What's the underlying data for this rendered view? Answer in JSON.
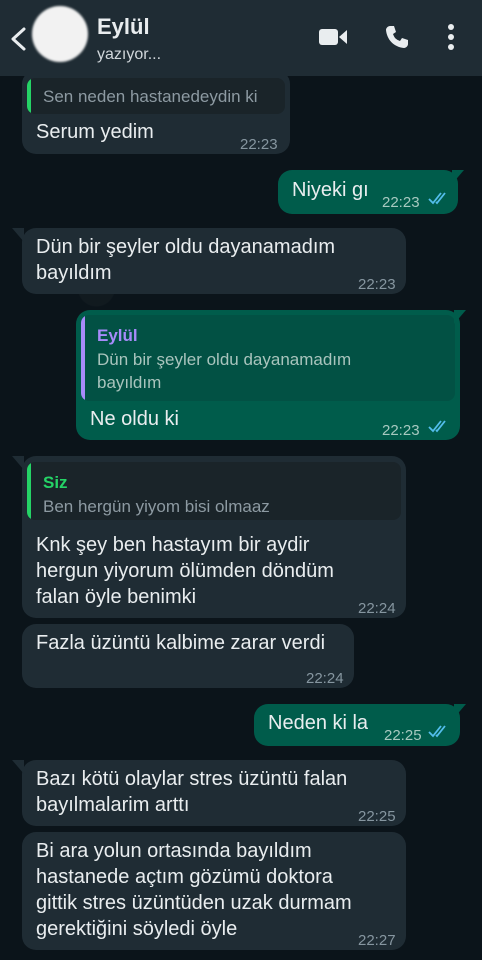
{
  "header": {
    "contact_name": "Eylül",
    "status": "yazıyor..."
  },
  "icons": [
    "back-arrow-icon",
    "video-call-icon",
    "phone-icon",
    "more-options-icon",
    "double-check-icon"
  ],
  "colors": {
    "outgoing": "#005c4b",
    "incoming": "#1f2c34",
    "tick": "#53bdeb",
    "eylul_quote": "#a78bfa",
    "you_quote": "#25d366"
  },
  "messages": [
    {
      "dir": "in",
      "quote_text": "Sen neden hastanedeydin ki",
      "lines": [
        "Serum yedim"
      ],
      "time": "22:23"
    },
    {
      "dir": "out",
      "lines": [
        "Niyeki gı"
      ],
      "time": "22:23"
    },
    {
      "dir": "in",
      "lines": [
        "Dün bir şeyler oldu dayanamadım",
        "bayıldım"
      ],
      "time": "22:23"
    },
    {
      "dir": "out",
      "quote_author": "Eylül",
      "quote_lines": [
        "Dün bir şeyler oldu dayanamadım",
        "bayıldım"
      ],
      "lines": [
        "Ne oldu ki"
      ],
      "time": "22:23"
    },
    {
      "dir": "in",
      "quote_author": "Siz",
      "quote_lines": [
        "Ben hergün yiyom bisi olmaaz"
      ],
      "lines": [
        "Knk şey ben hastayım bir aydir",
        "hergun yiyorum ölümden döndüm",
        "falan öyle benimki"
      ],
      "time": "22:24"
    },
    {
      "dir": "in",
      "lines": [
        "Fazla üzüntü kalbime zarar verdi"
      ],
      "time": "22:24"
    },
    {
      "dir": "out",
      "lines": [
        "Neden ki la"
      ],
      "time": "22:25"
    },
    {
      "dir": "in",
      "lines": [
        "Bazı kötü olaylar stres üzüntü falan",
        "bayılmalarim arttı"
      ],
      "time": "22:25"
    },
    {
      "dir": "in",
      "lines": [
        "Bi ara yolun ortasında bayıldım",
        "hastanede açtım gözümü doktora",
        "gittik stres üzüntüden uzak durmam",
        "gerektiğini söyledi öyle"
      ],
      "time": "22:27"
    }
  ]
}
